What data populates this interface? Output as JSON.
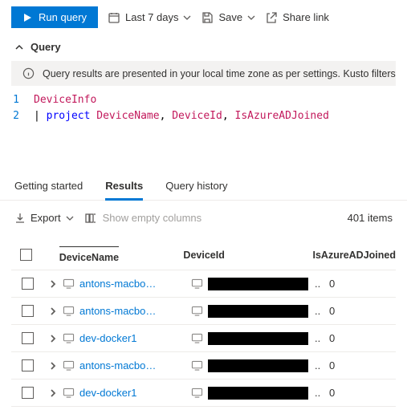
{
  "toolbar": {
    "run_label": "Run query",
    "time_label": "Last 7 days",
    "save_label": "Save",
    "share_label": "Share link"
  },
  "query_section": {
    "label": "Query"
  },
  "info_text": "Query results are presented in your local time zone as per settings. Kusto filters, however",
  "code": {
    "line1": {
      "num": "1",
      "text": "DeviceInfo"
    },
    "line2": {
      "num": "2",
      "pipe": "|",
      "kw": "project",
      "f1": "DeviceName",
      "c": ",",
      "f2": "DeviceId",
      "f3": "IsAzureADJoined"
    }
  },
  "tabs": {
    "t0": "Getting started",
    "t1": "Results",
    "t2": "Query history"
  },
  "results_bar": {
    "export": "Export",
    "show_empty": "Show empty columns",
    "count": "401 items"
  },
  "columns": {
    "c0": "DeviceName",
    "c1": "DeviceId",
    "c2": "IsAzureADJoined"
  },
  "rows": [
    {
      "name": "antons-macbo…",
      "join": "0"
    },
    {
      "name": "antons-macbo…",
      "join": "0"
    },
    {
      "name": "dev-docker1",
      "join": "0"
    },
    {
      "name": "antons-macbo…",
      "join": "0"
    },
    {
      "name": "dev-docker1",
      "join": "0"
    }
  ]
}
